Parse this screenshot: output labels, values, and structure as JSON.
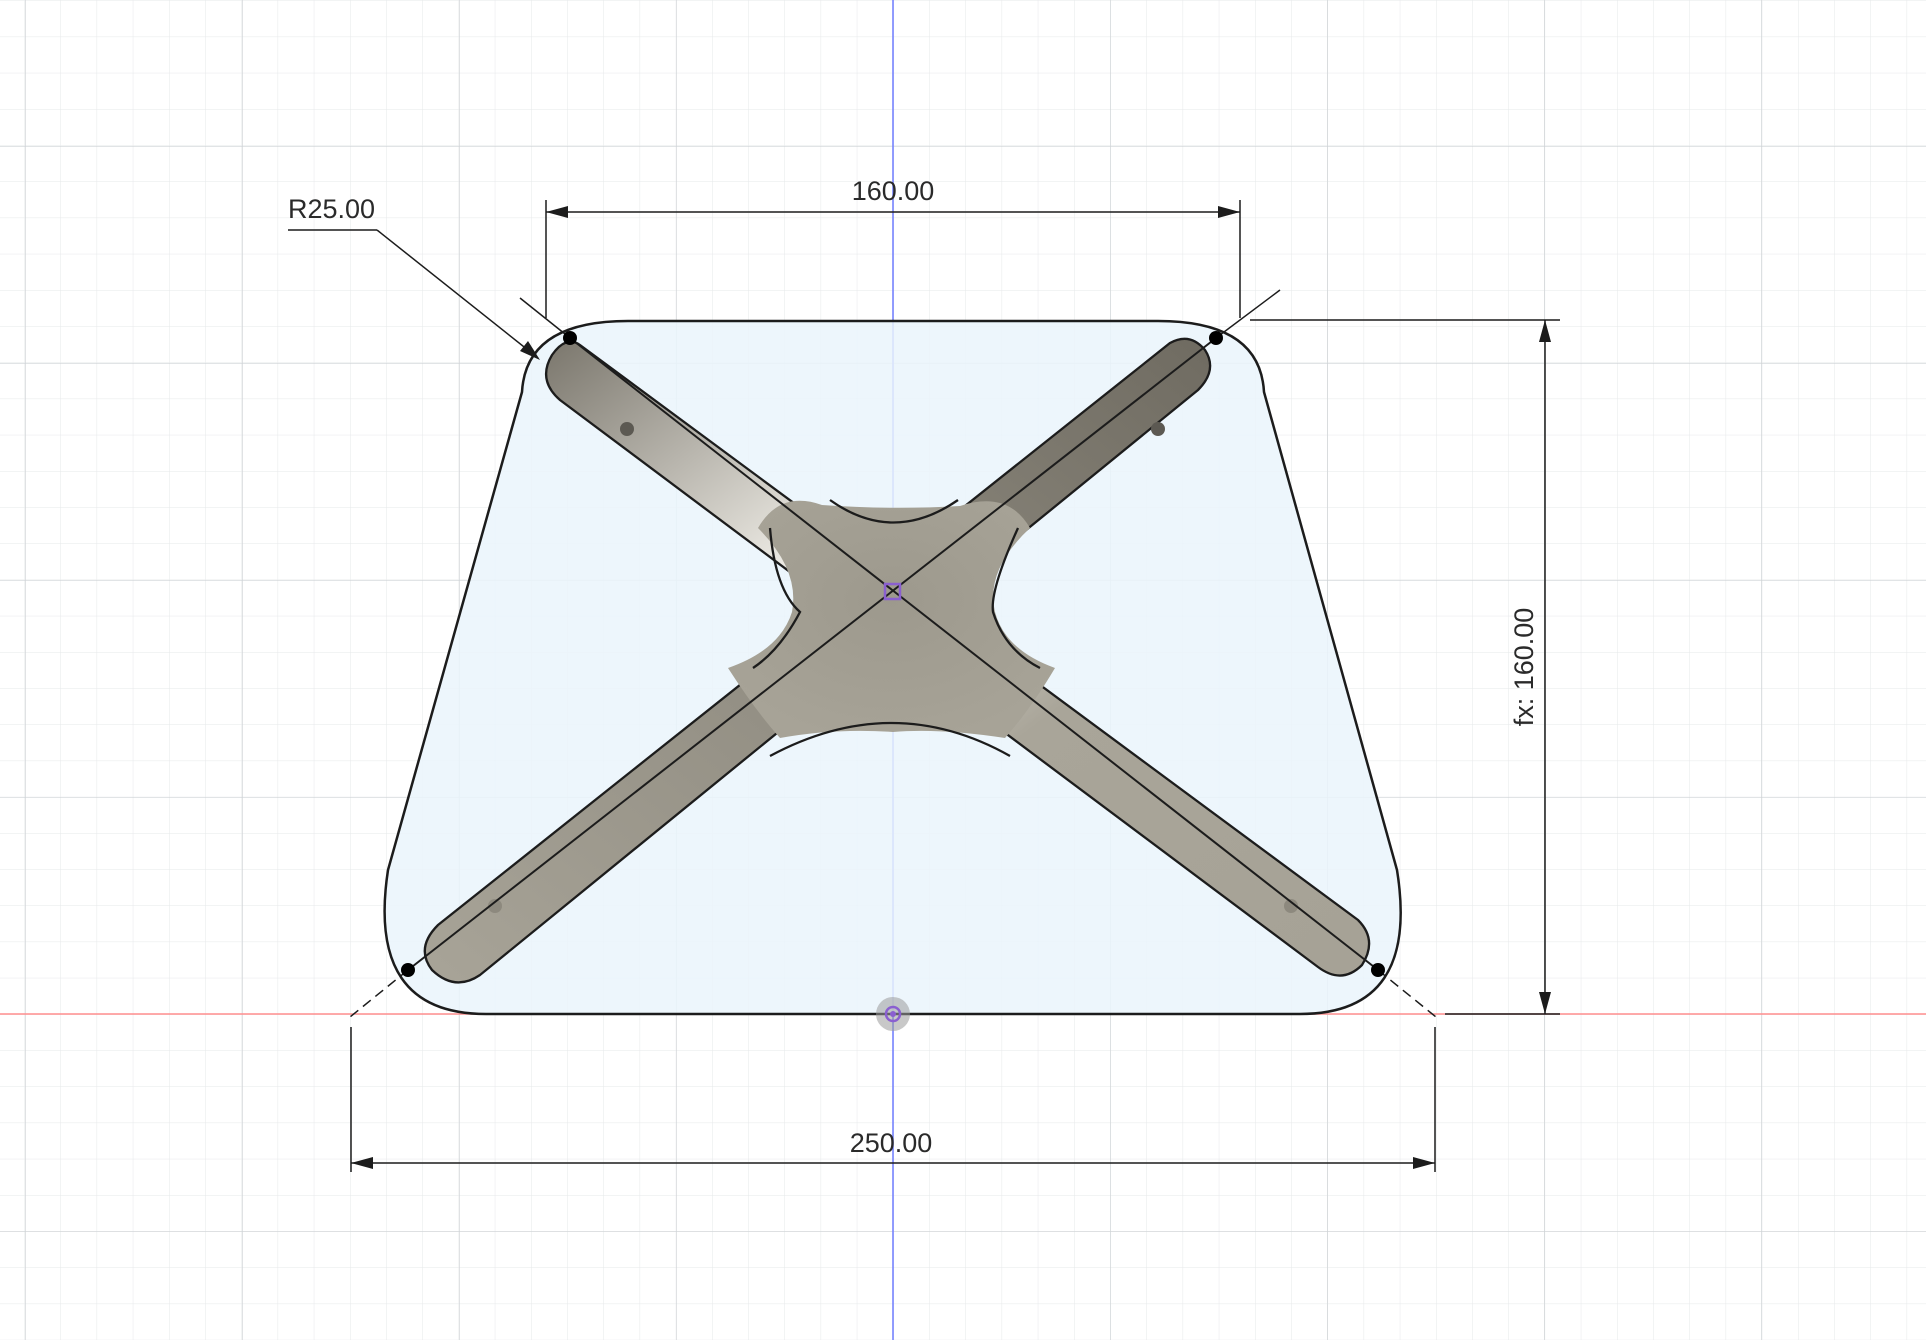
{
  "canvas": {
    "background": "#ffffff",
    "grid_minor_color": "#e6e8ea",
    "grid_major_color": "#cfd3d6",
    "axis_vertical_color": "#6f7cff",
    "axis_horizontal_color": "#ff8e8e"
  },
  "sketch": {
    "profile_fill": "#eaf4fc",
    "profile_stroke": "#1c1c1c",
    "body_color": "#a8a498",
    "constraint_point_color": "#000000",
    "center_point_color": "#8a5fd0"
  },
  "dimensions": {
    "top_width": "160.00",
    "bottom_width": "250.00",
    "height": "fx: 160.00",
    "radius": "R25.00"
  }
}
